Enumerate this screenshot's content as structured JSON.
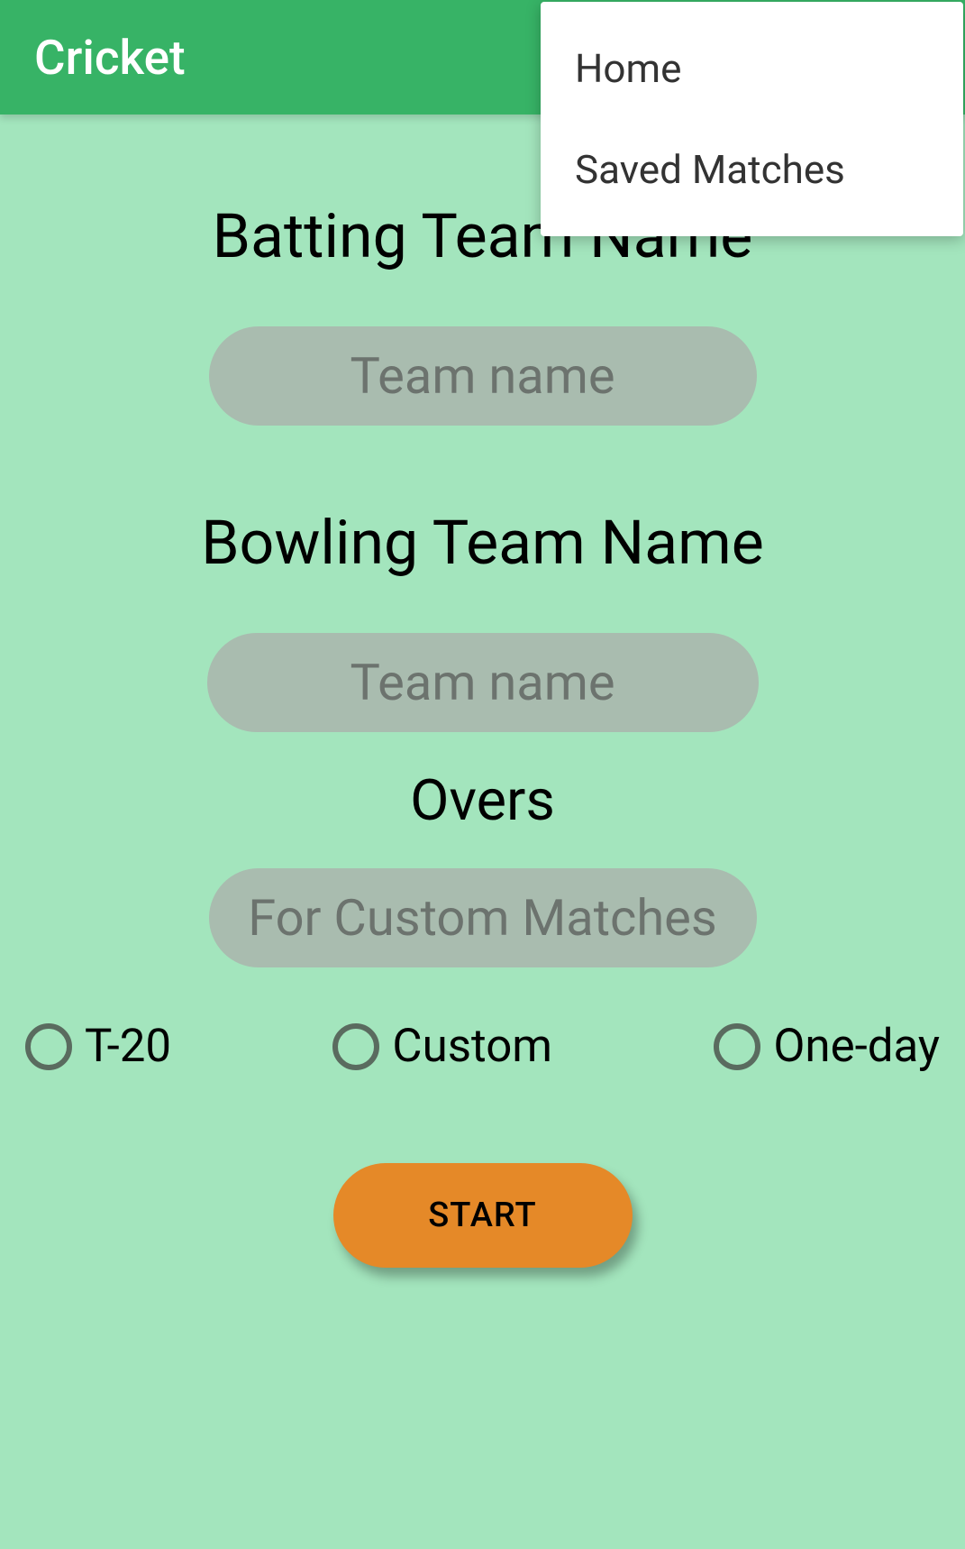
{
  "header": {
    "title": "Cricket"
  },
  "menu": {
    "items": [
      "Home",
      "Saved Matches"
    ]
  },
  "form": {
    "batting_label": "Batting Team Name",
    "batting_placeholder": "Team name",
    "bowling_label": "Bowling Team Name",
    "bowling_placeholder": "Team name",
    "overs_label": "Overs",
    "overs_placeholder": "For Custom Matches",
    "radio_options": {
      "t20": "T-20",
      "custom": "Custom",
      "oneday": "One-day"
    },
    "start_button": "START"
  }
}
